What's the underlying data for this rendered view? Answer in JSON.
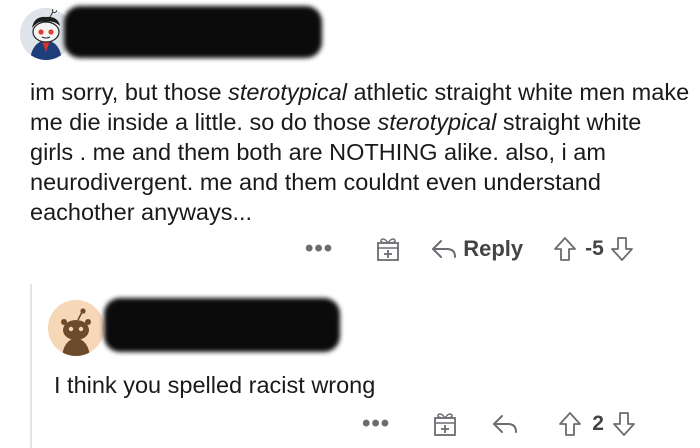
{
  "parent_comment": {
    "body_segments": [
      {
        "text": "im sorry, but those ",
        "italic": false
      },
      {
        "text": "sterotypical",
        "italic": true
      },
      {
        "text": " athletic straight white men make me die inside a little. so do those ",
        "italic": false
      },
      {
        "text": "sterotypical",
        "italic": true
      },
      {
        "text": " straight white girls . me and them both are NOTHING alike. also, i am neurodivergent. me and them couldnt even understand eachother anyways...",
        "italic": false
      }
    ],
    "more_label": "•••",
    "reply_label": "Reply",
    "vote_count": "-5"
  },
  "reply_comment": {
    "body": "I think you spelled racist wrong",
    "more_label": "•••",
    "vote_count": "2"
  },
  "icons": {
    "more": "more-options-icon",
    "award": "award-gift-icon",
    "reply": "reply-arrow-icon",
    "upvote": "upvote-arrow-icon",
    "downvote": "downvote-arrow-icon"
  },
  "colors": {
    "text": "#1a1a1a",
    "action_gray": "#6a6d71",
    "redaction": "#0b0b0b",
    "thread_line": "#e4e4e4"
  }
}
